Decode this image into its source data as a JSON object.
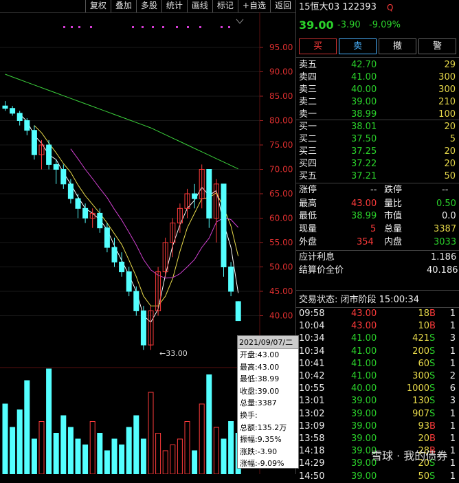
{
  "toolbar": {
    "buttons": [
      "复权",
      "叠加",
      "多股",
      "统计",
      "画线",
      "+自选",
      "返回"
    ],
    "label_marker": "标记"
  },
  "stock": {
    "title": "15恒大03 122393",
    "q_icon": "Q",
    "price": "39.00",
    "change": "-3.90",
    "change_pct": "-9.09%"
  },
  "actions": {
    "buy": "买",
    "sell": "卖",
    "cancel": "撤",
    "alert": "警"
  },
  "asks": [
    {
      "label": "卖五",
      "price": "42.70",
      "vol": "29"
    },
    {
      "label": "卖四",
      "price": "41.00",
      "vol": "300"
    },
    {
      "label": "卖三",
      "price": "40.00",
      "vol": "300"
    },
    {
      "label": "卖二",
      "price": "39.00",
      "vol": "210"
    },
    {
      "label": "卖一",
      "price": "38.99",
      "vol": "100"
    }
  ],
  "bids": [
    {
      "label": "买一",
      "price": "38.01",
      "vol": "20"
    },
    {
      "label": "买二",
      "price": "37.50",
      "vol": "5"
    },
    {
      "label": "买三",
      "price": "37.25",
      "vol": "20"
    },
    {
      "label": "买四",
      "price": "37.22",
      "vol": "20"
    },
    {
      "label": "买五",
      "price": "37.21",
      "vol": "50"
    }
  ],
  "stats": {
    "limit_up_label": "涨停",
    "limit_up": "--",
    "limit_down_label": "跌停",
    "limit_down": "--",
    "high_label": "最高",
    "high": "43.00",
    "ratio_label": "量比",
    "ratio": "0.50",
    "low_label": "最低",
    "low": "38.99",
    "pe_label": "市值",
    "pe": "0.0",
    "cur_vol_label": "现量",
    "cur_vol": "5",
    "total_vol_label": "总量",
    "total_vol": "3387",
    "outer_label": "外盘",
    "outer": "354",
    "inner_label": "内盘",
    "inner": "3033"
  },
  "interest": {
    "label": "应计利息",
    "value": "1.186",
    "full_label": "结算价全价",
    "full_value": "40.186"
  },
  "trade_status": "交易状态: 闭市阶段 15:00:34",
  "trades": [
    {
      "time": "09:58",
      "price": "43.00",
      "vol": "18",
      "side": "B",
      "n": "1",
      "pc": "red"
    },
    {
      "time": "10:04",
      "price": "43.00",
      "vol": "10",
      "side": "B",
      "n": "1",
      "pc": "red"
    },
    {
      "time": "10:34",
      "price": "41.00",
      "vol": "421",
      "side": "S",
      "n": "3",
      "pc": "green"
    },
    {
      "time": "10:34",
      "price": "41.00",
      "vol": "200",
      "side": "S",
      "n": "1",
      "pc": "green"
    },
    {
      "time": "10:41",
      "price": "41.00",
      "vol": "60",
      "side": "S",
      "n": "1",
      "pc": "green"
    },
    {
      "time": "10:42",
      "price": "41.00",
      "vol": "300",
      "side": "S",
      "n": "2",
      "pc": "green"
    },
    {
      "time": "10:55",
      "price": "40.00",
      "vol": "1000",
      "side": "S",
      "n": "6",
      "pc": "green"
    },
    {
      "time": "13:01",
      "price": "39.00",
      "vol": "130",
      "side": "S",
      "n": "3",
      "pc": "green"
    },
    {
      "time": "13:02",
      "price": "39.00",
      "vol": "907",
      "side": "S",
      "n": "1",
      "pc": "green"
    },
    {
      "time": "13:09",
      "price": "39.00",
      "vol": "93",
      "side": "B",
      "n": "1",
      "pc": "green"
    },
    {
      "time": "13:58",
      "price": "39.00",
      "vol": "20",
      "side": "B",
      "n": "1",
      "pc": "green"
    },
    {
      "time": "14:18",
      "price": "39.00",
      "vol": "28",
      "side": "B",
      "n": "1",
      "pc": "green"
    },
    {
      "time": "14:29",
      "price": "39.00",
      "vol": "20",
      "side": "S",
      "n": "1",
      "pc": "green"
    },
    {
      "time": "14:50",
      "price": "39.00",
      "vol": "50",
      "side": "S",
      "n": "1",
      "pc": "green"
    }
  ],
  "tooltip": {
    "date": "2021/09/07/二",
    "lines": [
      "开盘:43.00",
      "最高:43.00",
      "最低:38.99",
      "收盘:39.00",
      "总量:3387",
      "换手:",
      "总额:135.2万",
      "振幅:9.35%",
      "涨跌:-3.90",
      "涨幅:-9.09%"
    ]
  },
  "chart_data": {
    "type": "candlestick",
    "price_ticks": [
      "95.00",
      "90.00",
      "85.00",
      "80.00",
      "75.00",
      "70.00",
      "65.00",
      "60.00",
      "55.00",
      "50.00",
      "45.00",
      "40.00"
    ],
    "low_marker": "33.00",
    "candles": [
      [
        83,
        84,
        82,
        82.5
      ],
      [
        82.5,
        83,
        81,
        81.5
      ],
      [
        81.5,
        82,
        79,
        80
      ],
      [
        80,
        80.5,
        77,
        78
      ],
      [
        78,
        79,
        72,
        73
      ],
      [
        73,
        76,
        70,
        75
      ],
      [
        75,
        76,
        70,
        71
      ],
      [
        71,
        72,
        67,
        70
      ],
      [
        70,
        71,
        66,
        67
      ],
      [
        67,
        68,
        63,
        64
      ],
      [
        64,
        65,
        60,
        62
      ],
      [
        62,
        63,
        59,
        60
      ],
      [
        60,
        62,
        58,
        61
      ],
      [
        61,
        62,
        57,
        58
      ],
      [
        58,
        59,
        53,
        54
      ],
      [
        54,
        56,
        50,
        51
      ],
      [
        51,
        53,
        48,
        49
      ],
      [
        49,
        50,
        44,
        45
      ],
      [
        45,
        46,
        40,
        41
      ],
      [
        41,
        42,
        33,
        34
      ],
      [
        34,
        42,
        33,
        41
      ],
      [
        41,
        50,
        40,
        49
      ],
      [
        49,
        56,
        48,
        55
      ],
      [
        55,
        60,
        52,
        59
      ],
      [
        59,
        63,
        57,
        62
      ],
      [
        62,
        66,
        60,
        65
      ],
      [
        65,
        67,
        62,
        64
      ],
      [
        64,
        71,
        62,
        70
      ],
      [
        70,
        70,
        58,
        60
      ],
      [
        60,
        68,
        55,
        67
      ],
      [
        67,
        67,
        48,
        50
      ],
      [
        50,
        51,
        44,
        45
      ],
      [
        42.9,
        43,
        38.99,
        39
      ]
    ],
    "volume": [
      60,
      40,
      55,
      80,
      30,
      45,
      90,
      35,
      50,
      40,
      30,
      25,
      45,
      35,
      20,
      30,
      25,
      40,
      50,
      30,
      70,
      35,
      20,
      25,
      30,
      45,
      20,
      60,
      85,
      40,
      30,
      45,
      35
    ]
  },
  "watermark": "雪球 · 我的债券"
}
